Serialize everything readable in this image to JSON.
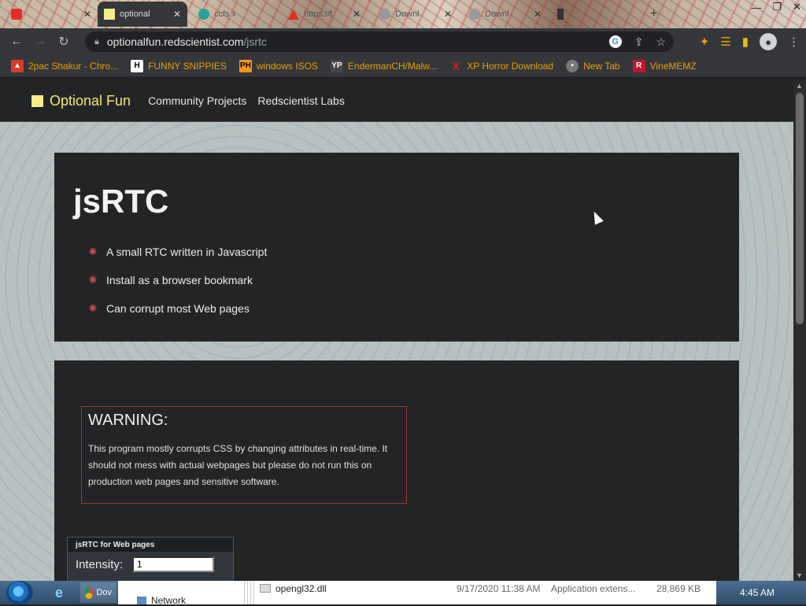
{
  "browser": {
    "tabs": [
      {
        "label": "",
        "icon": "youtube-icon",
        "active": false
      },
      {
        "label": "optional",
        "icon": "optionalfun-favicon",
        "active": true
      },
      {
        "label": "ccfs x",
        "icon": "globe-icon",
        "active": false
      },
      {
        "label": "https://f",
        "icon": "warning-icon",
        "active": false
      },
      {
        "label": "Downl",
        "icon": "download-icon",
        "active": false
      },
      {
        "label": "Downl",
        "icon": "download-icon",
        "active": false
      }
    ],
    "url_host": "optionalfun.redscientist.com",
    "url_path": "/jsrtc",
    "bookmarks": [
      {
        "label": "2pac Shakur - Chro...",
        "icon": "bookmark-2pac-icon",
        "color": "#d63b2b"
      },
      {
        "label": "FUNNY SNIPPIES",
        "icon": "h-logo-icon",
        "color": "#3a3a3a"
      },
      {
        "label": "windows ISOS",
        "icon": "ph-logo-icon",
        "color": "#f7971d"
      },
      {
        "label": "EndermanCH/Malw...",
        "icon": "yp-logo-icon",
        "color": "#444"
      },
      {
        "label": "XP Horror Download",
        "icon": "x-logo-icon",
        "color": "#d81b1b"
      },
      {
        "label": "New Tab",
        "icon": "newtab-icon",
        "color": "#777"
      },
      {
        "label": "VineMEMZ",
        "icon": "r-logo-icon",
        "color": "#c0152f"
      }
    ]
  },
  "site": {
    "brand": "Optional Fun",
    "nav": [
      "Community Projects",
      "Redscientist Labs"
    ],
    "title": "jsRTC",
    "features": [
      "A small RTC written in Javascript",
      "Install as a browser bookmark",
      "Can corrupt most Web pages"
    ],
    "warning_title": "WARNING:",
    "warning_text": "This program mostly corrupts CSS by changing attributes in real-time. It should not mess with actual webpages but please do not run this on production web pages and sensitive software.",
    "panel_title": "jsRTC for Web pages",
    "intensity_label": "Intensity:",
    "intensity_value": "1"
  },
  "taskbar": {
    "explorer_rows": [
      {
        "name": "opengl32.dll",
        "date": "9/17/2020 11:38 AM",
        "type": "Application extens...",
        "size": "28,869 KB"
      },
      {
        "name": "Network",
        "date": "",
        "type": "",
        "size": ""
      }
    ],
    "chrome_label": "Dov",
    "clock": "4:45 AM"
  },
  "colors": {
    "brand_yellow": "#f5e86a",
    "warning_border": "#a0353a",
    "card_bg": "#222426"
  }
}
